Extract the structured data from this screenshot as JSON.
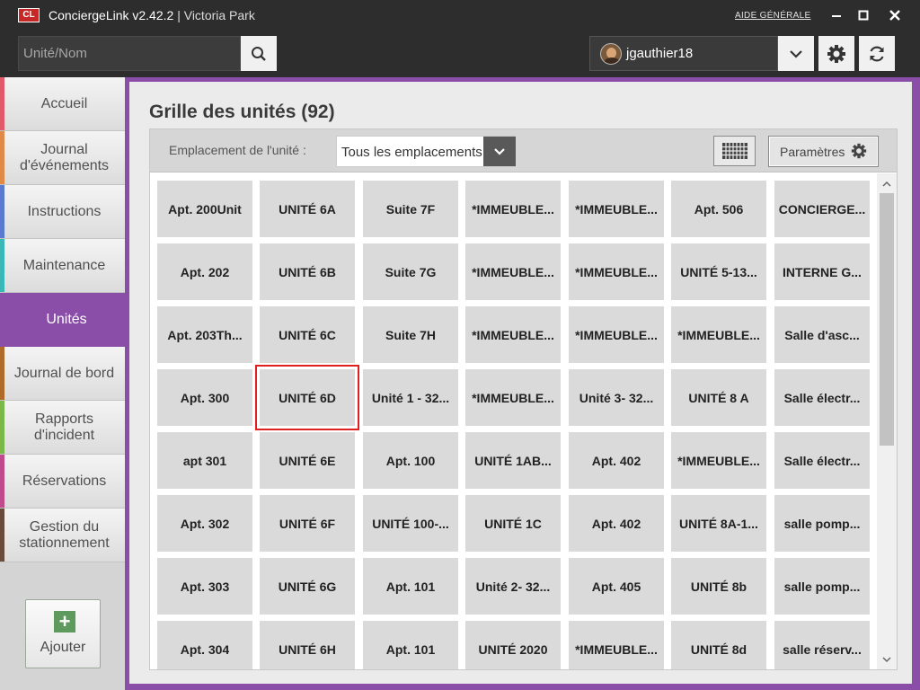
{
  "window": {
    "logo_text": "CL",
    "app_name": "ConciergeLink v2.42.2",
    "separator": "|",
    "site": "Victoria Park",
    "help_link": "AIDE GÉNÉRALE"
  },
  "search": {
    "placeholder": "Unité/Nom",
    "value": ""
  },
  "user": {
    "username": "jgauthier18"
  },
  "sidebar": {
    "items": [
      {
        "label": "Accueil",
        "color": "#e05a6a"
      },
      {
        "label": "Journal d'événements",
        "color": "#e08a4a"
      },
      {
        "label": "Instructions",
        "color": "#5a7ad0"
      },
      {
        "label": "Maintenance",
        "color": "#3ab8b8"
      },
      {
        "label": "Unités",
        "color": "#8a4ea8"
      },
      {
        "label": "Journal de bord",
        "color": "#b06a2a"
      },
      {
        "label": "Rapports d'incident",
        "color": "#7ab84a"
      },
      {
        "label": "Réservations",
        "color": "#c04a8a"
      },
      {
        "label": "Gestion du stationnement",
        "color": "#6a4a3a"
      }
    ],
    "active_item": "Unités",
    "add_button": "Ajouter"
  },
  "main": {
    "title": "Grille des unités (92)",
    "filter_label": "Emplacement de l'unité :",
    "location_value": "Tous les emplacements",
    "params_label": "Paramètres",
    "selected_unit": "UNITÉ 6D",
    "units": [
      [
        "Apt. 200Unit",
        "UNITÉ 6A",
        "Suite 7F",
        "*IMMEUBLE...",
        "*IMMEUBLE...",
        "Apt. 506",
        "CONCIERGE..."
      ],
      [
        "Apt. 202",
        "UNITÉ 6B",
        "Suite 7G",
        "*IMMEUBLE...",
        "*IMMEUBLE...",
        "UNITÉ 5-13...",
        "INTERNE G..."
      ],
      [
        "Apt. 203Th...",
        "UNITÉ 6C",
        "Suite 7H",
        "*IMMEUBLE...",
        "*IMMEUBLE...",
        "*IMMEUBLE...",
        "Salle d'asc..."
      ],
      [
        "Apt. 300",
        "UNITÉ 6D",
        "Unité 1 - 32...",
        "*IMMEUBLE...",
        "Unité 3- 32...",
        "UNITÉ 8 A",
        "Salle électr..."
      ],
      [
        "apt 301",
        "UNITÉ 6E",
        "Apt. 100",
        "UNITÉ 1AB...",
        "Apt. 402",
        "*IMMEUBLE...",
        "Salle électr..."
      ],
      [
        "Apt. 302",
        "UNITÉ 6F",
        "UNITÉ 100-...",
        "UNITÉ 1C",
        "Apt. 402",
        "UNITÉ 8A-1...",
        "salle pomp..."
      ],
      [
        "Apt. 303",
        "UNITÉ 6G",
        "Apt. 101",
        "Unité 2- 32...",
        "Apt. 405",
        "UNITÉ 8b",
        "salle pomp..."
      ],
      [
        "Apt. 304",
        "UNITÉ 6H",
        "Apt. 101",
        "UNITÉ 2020",
        "*IMMEUBLE...",
        "UNITÉ 8d",
        "salle réserv..."
      ]
    ]
  }
}
